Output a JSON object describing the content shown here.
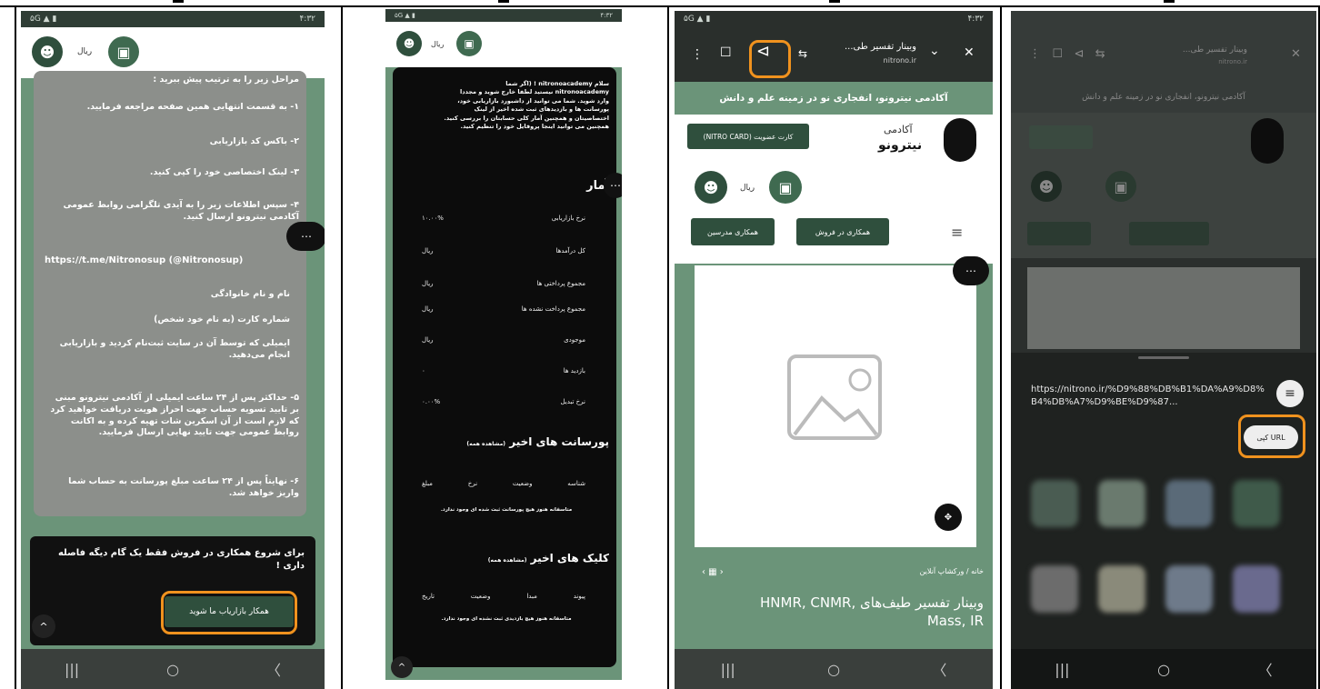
{
  "shared": {
    "status_time": "۴:۳۲",
    "status_left": "۵G ▲ ▮",
    "currency": "ریال",
    "nav_back": "〈",
    "nav_home": "○",
    "nav_recent": "|||"
  },
  "panel1": {
    "intro": "مراحل زیر را به ترتیب پیش ببرید :",
    "steps": [
      "۱- به قسمت انتهایی همین صفحه مراجعه فرمایید.",
      "۲- باکس کد بازاریابی",
      "۳- لینک اختصاصی خود را کپی کنید.",
      "۴- سپس اطلاعات زیر را به آیدی تلگرامی روابط عمومی آکادمی نیترونو ارسال کنید."
    ],
    "telegram": "https://t.me/Nitronosup  (@Nitronosup)",
    "bullets": [
      "نام و نام خانوادگی",
      "شماره کارت (به نام خود شخص)",
      "ایمیلی که توسط آن در سایت ثبت‌نام کردید و بازاریابی انجام می‌دهید."
    ],
    "step5": "۵- حداکثر پس از ۲۴ ساعت ایمیلی از آکادمی نیترونو مبنی بر تایید تسویه حساب جهت احراز هویت دریافت خواهید کرد که لازم است از آن اسکرین شات تهیه کرده و به اکانت روابط عمومی جهت تایید نهایی ارسال فرمایید.",
    "step6": "۶- نهایتاً پس از ۲۴ ساعت مبلغ پورسانت به حساب شما واریز خواهد شد.",
    "cta_text": "برای شروع همکاری در فروش فقط یک گام دیگه فاصله داری !",
    "cta_button": "همکار بازاریاب ما شوید",
    "dots": "⋯",
    "up": "^"
  },
  "panel2": {
    "header_lines": [
      "سلام nitronoacademy ! (اگر شما",
      "nitronoacademy نیستید لطفا خارج شوید و مجددا",
      "وارد شوید. شما می توانید از داشبورد بازاریابی خود،",
      "پورسانت ها و بازدیدهای ثبت شده اخیر از لینک",
      "اختصاصیتان و همچنین آمار کلی حسابتان را بررسی کنید.",
      "همچنین می توانید اینجا پروفایل خود را تنظیم کنید."
    ],
    "stats_title": "آمار",
    "stats": [
      {
        "label": "نرخ بازاریابی",
        "value": "۱۰.۰۰%"
      },
      {
        "label": "کل درآمدها",
        "value": "ریال"
      },
      {
        "label": "مجموع پرداختی ها",
        "value": "ریال"
      },
      {
        "label": "مجموع پرداخت نشده ها",
        "value": "ریال"
      },
      {
        "label": "موجودی",
        "value": "ریال"
      },
      {
        "label": "بازدید ها",
        "value": "۰"
      },
      {
        "label": "نرخ تبدیل",
        "value": "۰.۰۰%"
      }
    ],
    "commissions_title": "پورسانت های اخیر",
    "view_all": "(مشاهده همه)",
    "commissions_headers": [
      "شناسه",
      "وضعیت",
      "نرخ",
      "مبلغ"
    ],
    "commissions_empty": "متاسفانه هنوز هیچ پورسانت ثبت شده ای وجود ندارد.",
    "clicks_title": "کلیک های اخیر",
    "clicks_headers": [
      "پیوند",
      "مبدا",
      "وضعیت",
      "تاریخ"
    ],
    "clicks_empty": "متاسفانه هنوز هیچ بازدیدی ثبت نشده ای وجود ندارد."
  },
  "panel3": {
    "tab_title": "وبینار تفسیر طی...",
    "tab_domain": "nitrono.ir",
    "banner": "آکادمی نیترونو، انفجاری نو در زمینه علم و دانش",
    "membership_button": "کارت عضویت (NITRO CARD)",
    "logo_small": "آکادمی",
    "logo_big": "نیترونو",
    "btn_teacher": "همکاری مدرسین",
    "btn_sales": "همکاری در فروش",
    "breadcrumb": "خانه / ورکشاپ آنلاین",
    "product_title": "وبینار تفسیر طیف‌های HNMR, CNMR, Mass, IR",
    "close": "✕"
  },
  "panel4": {
    "url": "https://nitrono.ir/%D9%88%DB%B1%DA%A9%D8%B4%DB%A7%D9%BE%D9%87...",
    "copy_url": "کپی URL",
    "tab_title": "وبینار تفسیر طی...",
    "tab_domain": "nitrono.ir",
    "banner": "آکادمی نیترونو، انفجاری نو در زمینه علم و دانش"
  },
  "colors": {
    "green": "#6b9479",
    "dark_green": "#2f4f3d",
    "orange_highlight": "#f0921e"
  }
}
